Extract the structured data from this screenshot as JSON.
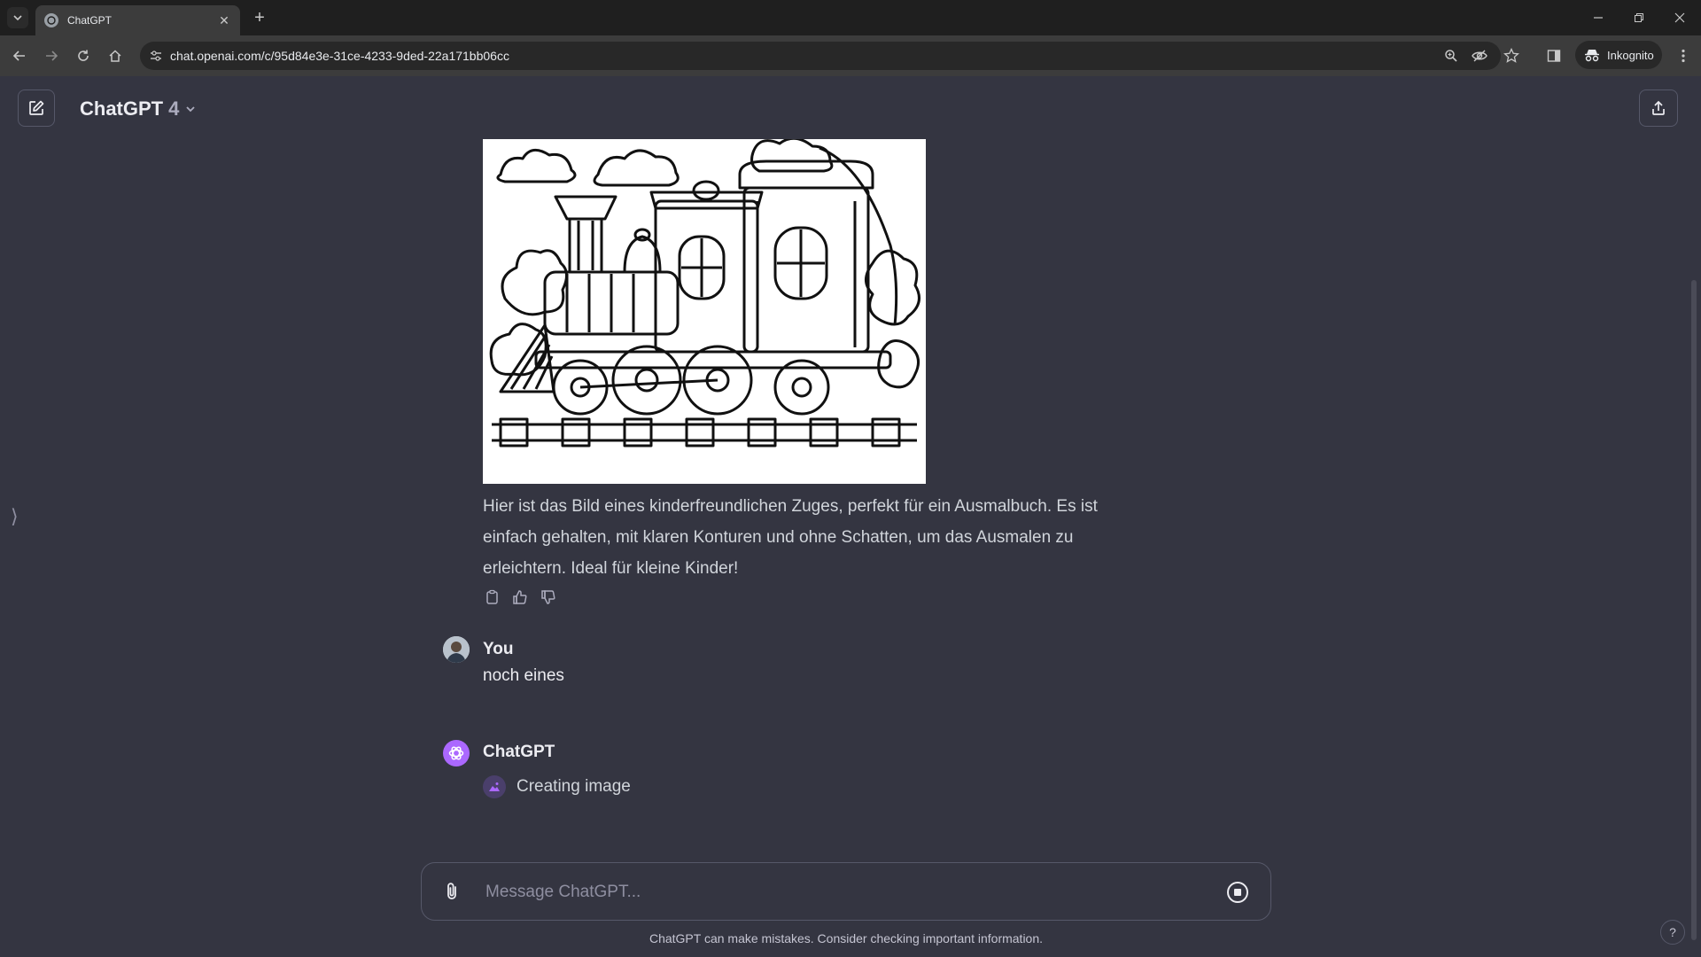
{
  "browser": {
    "tab_title": "ChatGPT",
    "url": "chat.openai.com/c/95d84e3e-31ce-4233-9ded-22a171bb06cc",
    "incognito_label": "Inkognito"
  },
  "header": {
    "model_name": "ChatGPT",
    "model_version": "4"
  },
  "conversation": {
    "assistant_message_1": "Hier ist das Bild eines kinderfreundlichen Zuges, perfekt für ein Ausmalbuch. Es ist einfach gehalten, mit klaren Konturen und ohne Schatten, um das Ausmalen zu erleichtern. Ideal für kleine Kinder!",
    "user_author": "You",
    "user_message": "noch eines",
    "assistant_author": "ChatGPT",
    "creating_status": "Creating image"
  },
  "composer": {
    "placeholder": "Message ChatGPT..."
  },
  "footer": {
    "disclaimer": "ChatGPT can make mistakes. Consider checking important information.",
    "help_label": "?"
  },
  "colors": {
    "background": "#343541",
    "accent_gpt": "#ab68ff"
  }
}
